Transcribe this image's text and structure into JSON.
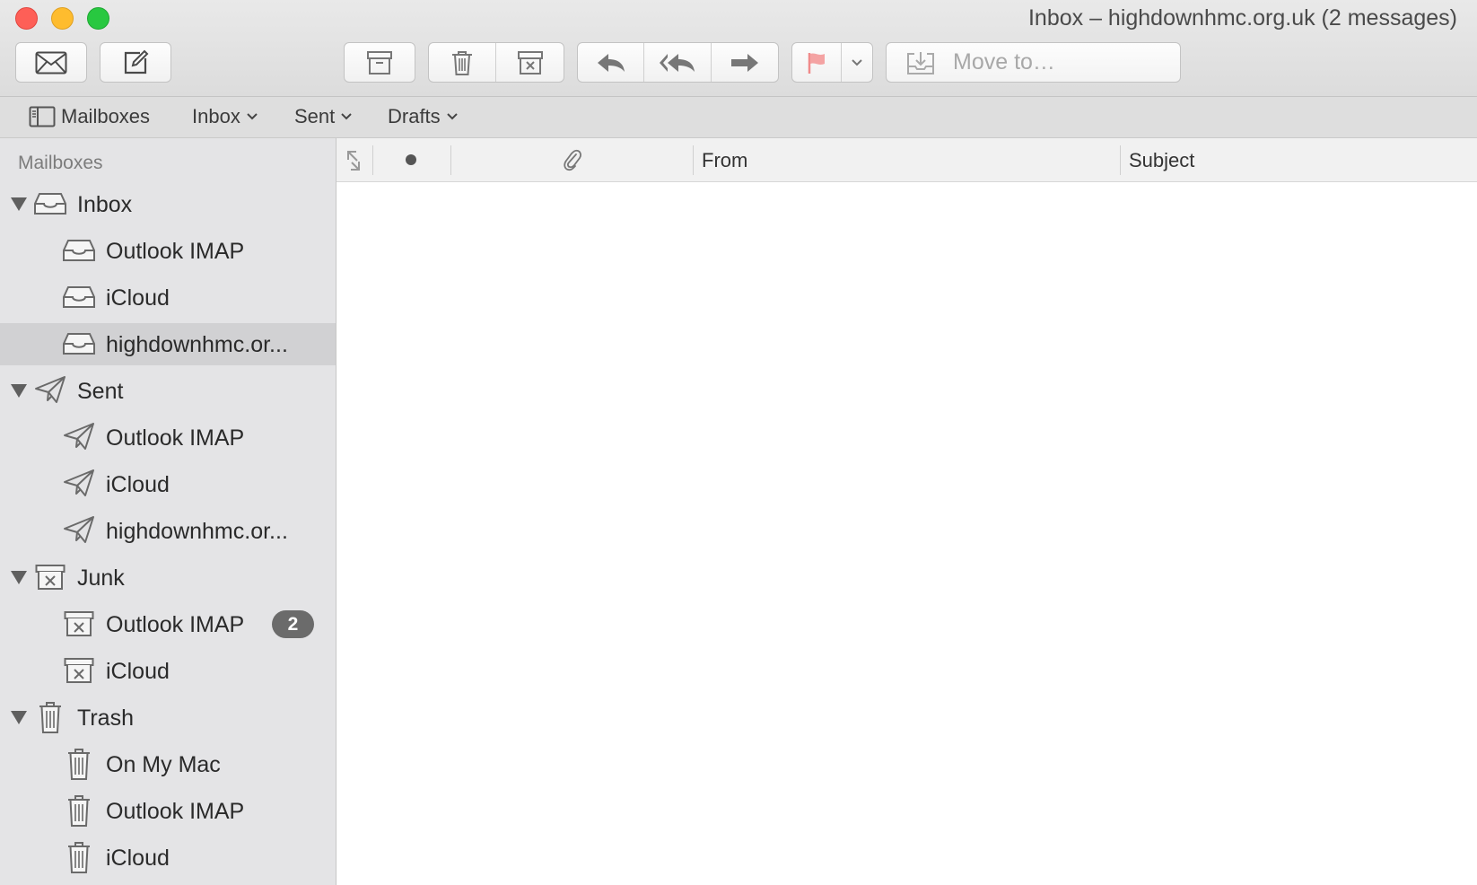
{
  "window": {
    "title": "Inbox – highdownhmc.org.uk (2 messages)"
  },
  "toolbar": {
    "get_mail_icon": "envelope-icon",
    "compose_icon": "compose-icon",
    "move_to_placeholder": "Move to…"
  },
  "favorites": {
    "mailboxes_label": "Mailboxes",
    "inbox_label": "Inbox",
    "sent_label": "Sent",
    "drafts_label": "Drafts"
  },
  "sidebar": {
    "header": "Mailboxes",
    "groups": [
      {
        "label": "Inbox",
        "icon": "inbox-tray-icon",
        "items": [
          {
            "label": "Outlook IMAP"
          },
          {
            "label": "iCloud"
          },
          {
            "label": "highdownhmc.or..."
          }
        ]
      },
      {
        "label": "Sent",
        "icon": "paper-plane-icon",
        "items": [
          {
            "label": "Outlook IMAP"
          },
          {
            "label": "iCloud"
          },
          {
            "label": "highdownhmc.or..."
          }
        ]
      },
      {
        "label": "Junk",
        "icon": "junk-box-icon",
        "items": [
          {
            "label": "Outlook IMAP",
            "badge": "2"
          },
          {
            "label": "iCloud"
          }
        ]
      },
      {
        "label": "Trash",
        "icon": "trash-can-icon",
        "items": [
          {
            "label": "On My Mac"
          },
          {
            "label": "Outlook IMAP"
          },
          {
            "label": "iCloud"
          }
        ]
      }
    ]
  },
  "message_list": {
    "columns": {
      "from": "From",
      "subject": "Subject"
    }
  }
}
